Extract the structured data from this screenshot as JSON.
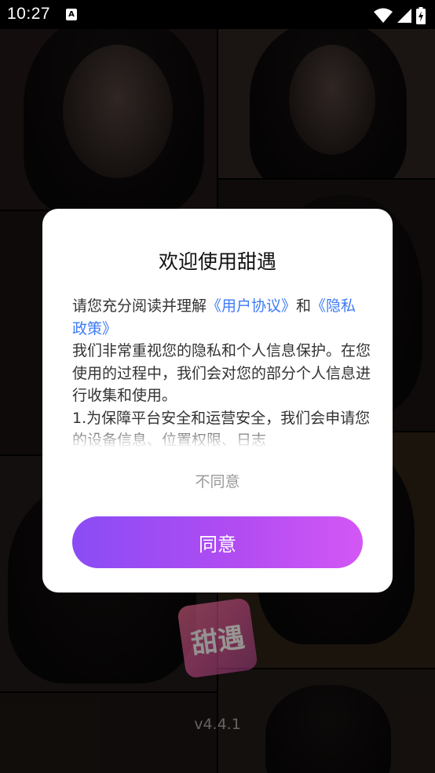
{
  "status_bar": {
    "time": "10:27",
    "notification_icon": "A"
  },
  "dialog": {
    "title": "欢迎使用甜遇",
    "intro_prefix": "请您充分阅读并理解",
    "link_user_agreement": "《用户协议》",
    "intro_and": "和",
    "link_privacy_policy": "《隐私政策》",
    "paragraph_1": "我们非常重视您的隐私和个人信息保护。在您使用的过程中，我们会对您的部分个人信息进行收集和使用。",
    "paragraph_2": " 1.为保障平台安全和运营安全，我们会申请您的设备信息、位置权限、日志",
    "disagree_label": "不同意",
    "agree_label": "同意"
  },
  "app": {
    "logo_text": "甜遇",
    "version": "v4.4.1"
  },
  "colors": {
    "link": "#3d7bf7",
    "agree_gradient_start": "#8a4cf5",
    "agree_gradient_end": "#d357f5"
  },
  "icons": [
    "wifi-icon",
    "signal-icon",
    "battery-icon"
  ]
}
